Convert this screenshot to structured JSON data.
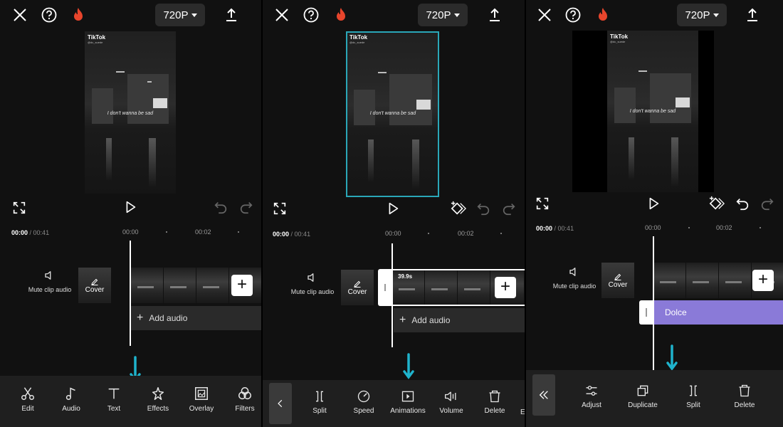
{
  "resolution": "720P",
  "preview": {
    "logo": "TikTok",
    "handle": "@dc_suede",
    "caption": "I don't wanna be sad"
  },
  "timeline": {
    "current": "00:00",
    "total": "/ 00:41",
    "mark_1": "00:00",
    "mark_2": "00:02",
    "clip_duration": "39.9s"
  },
  "side": {
    "mute": "Mute clip audio",
    "cover": "Cover",
    "add_audio": "Add audio"
  },
  "audio_track": "Dolce",
  "toolbar1": [
    "Edit",
    "Audio",
    "Text",
    "Effects",
    "Overlay",
    "Filters"
  ],
  "toolbar2": [
    "Split",
    "Speed",
    "Animations",
    "Volume",
    "Delete"
  ],
  "toolbar2_clipped": "E",
  "toolbar3": [
    "Adjust",
    "Duplicate",
    "Split",
    "Delete"
  ],
  "colors": {
    "accent": "#2aa7b8",
    "audio": "#8a7ad8",
    "flame": "#e8452c"
  },
  "icons": [
    "close-icon",
    "help-icon",
    "flame-icon",
    "upload-icon",
    "fullscreen-icon",
    "play-icon",
    "undo-icon",
    "redo-icon",
    "keyframe-icon"
  ]
}
